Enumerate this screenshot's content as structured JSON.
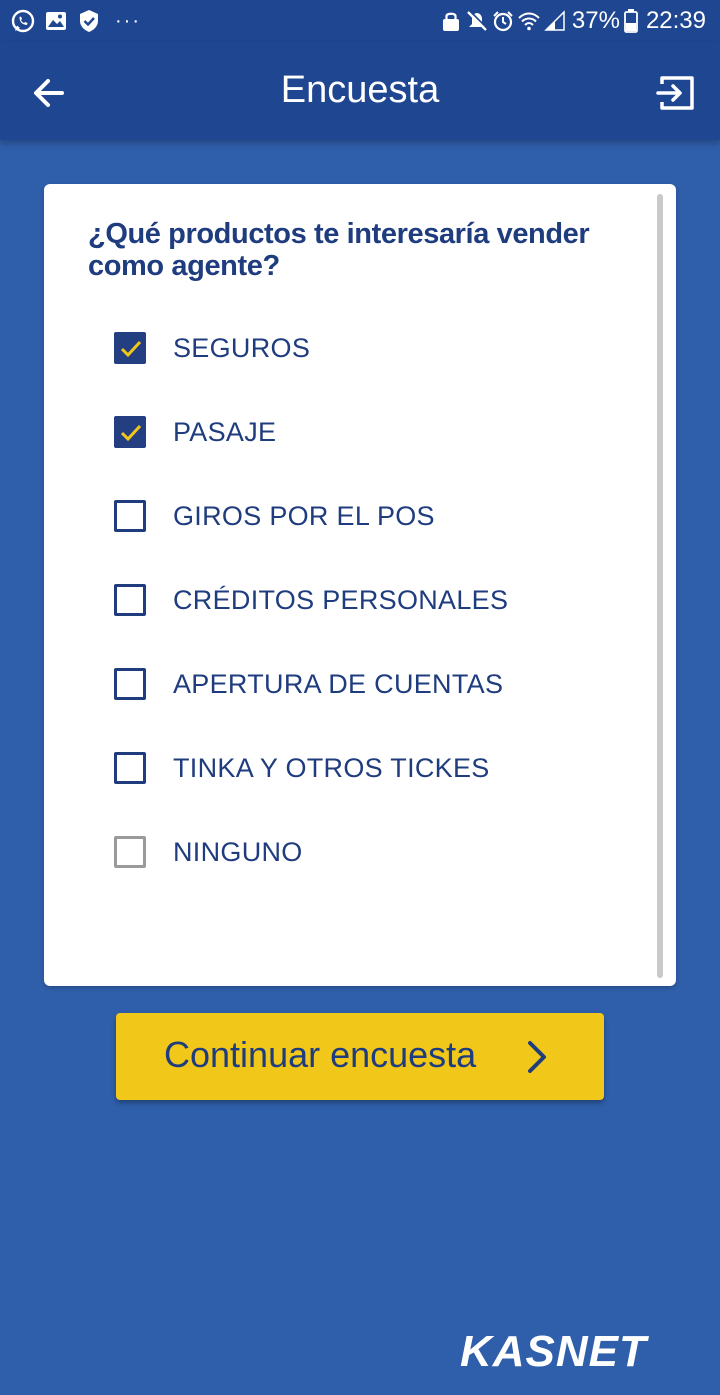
{
  "status_bar": {
    "battery": "37%",
    "time": "22:39",
    "left_icons": [
      "whatsapp-icon",
      "gallery-icon",
      "shield-icon",
      "more-dots-icon"
    ],
    "right_icons": [
      "lock-icon",
      "no-notification-icon",
      "alarm-icon",
      "wifi-icon",
      "signal-icon",
      "battery-icon"
    ],
    "more": "···"
  },
  "app_bar": {
    "title": "Encuesta",
    "back_icon": "arrow-left-icon",
    "exit_icon": "exit-icon",
    "background": "#1f4690"
  },
  "survey": {
    "question": "¿Qué productos te interesaría vender como agente?",
    "options": [
      {
        "label": "SEGUROS",
        "checked": true
      },
      {
        "label": "PASAJE",
        "checked": true
      },
      {
        "label": "GIROS POR EL POS",
        "checked": false
      },
      {
        "label": "CRÉDITOS PERSONALES",
        "checked": false
      },
      {
        "label": "APERTURA DE CUENTAS",
        "checked": false
      },
      {
        "label": "TINKA Y OTROS TICKES",
        "checked": false
      },
      {
        "label": "NINGUNO",
        "checked": false
      }
    ]
  },
  "continue_button": {
    "label": "Continuar encuesta",
    "icon": "chevron-right-icon",
    "color": "#f1c819"
  },
  "brand": {
    "logo_text": "KASNET"
  },
  "colors": {
    "background": "#2f5eaa",
    "primary_text": "#1f3c7f",
    "check_mark": "#f1c819"
  }
}
